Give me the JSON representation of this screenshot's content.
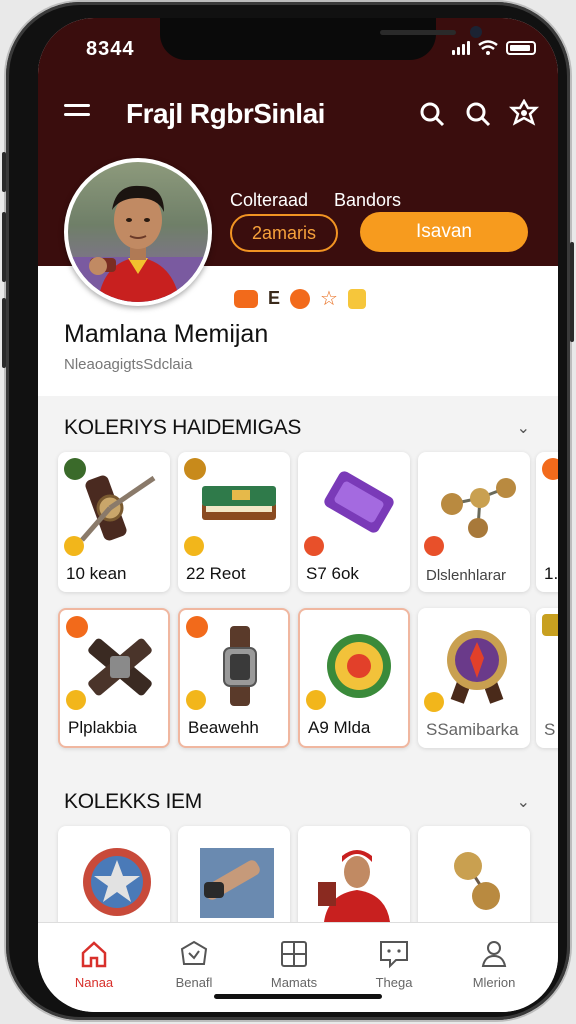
{
  "status": {
    "time": "8344"
  },
  "app": {
    "title": "Frajl RgbrSinlai"
  },
  "profile": {
    "name": "Mamlana Memijan",
    "handle": "NleaoagigtsSdclaia",
    "label_left": "Colteraad",
    "label_right": "Bandors",
    "pill_outline": "2amaris",
    "pill_button": "Isavan",
    "badge_text": "E"
  },
  "sections": [
    {
      "title": "KOLERIYS HAIDEMIGAS",
      "row1": [
        {
          "label": "10 kean",
          "icon": "watch-tool-icon"
        },
        {
          "label": "22 Reot",
          "icon": "book-icon"
        },
        {
          "label": "S7 6ok",
          "icon": "scroll-icon"
        },
        {
          "label": "Dlslenhlarar",
          "icon": "molecule-icon"
        },
        {
          "label": "1.",
          "icon": "partial-item-icon"
        }
      ],
      "row2": [
        {
          "label": "Plplakbia",
          "icon": "cross-straps-icon"
        },
        {
          "label": "Beawehh",
          "icon": "wristwatch-icon"
        },
        {
          "label": "A9 Mlda",
          "icon": "laurel-emblem-icon"
        },
        {
          "label": "SSamibarka",
          "icon": "medal-icon"
        },
        {
          "label": "S",
          "icon": "partial-item-icon"
        }
      ]
    },
    {
      "title": "KOLEKKS IEM",
      "row": [
        {
          "label": "",
          "icon": "shield-star-icon"
        },
        {
          "label": "",
          "icon": "watch-photo-icon"
        },
        {
          "label": "",
          "icon": "player-photo-icon"
        },
        {
          "label": "",
          "icon": "coins-icon"
        }
      ]
    }
  ],
  "nav": [
    {
      "label": "Nanaa",
      "icon": "home-icon",
      "active": true
    },
    {
      "label": "Benafl",
      "icon": "box-icon",
      "active": false
    },
    {
      "label": "Mamats",
      "icon": "add-square-icon",
      "active": false
    },
    {
      "label": "Thega",
      "icon": "chat-icon",
      "active": false
    },
    {
      "label": "Mlerion",
      "icon": "profile-icon",
      "active": false
    }
  ],
  "colors": {
    "hero": "#3a0d0d",
    "accent": "#f79b1e",
    "active": "#d8302b"
  }
}
